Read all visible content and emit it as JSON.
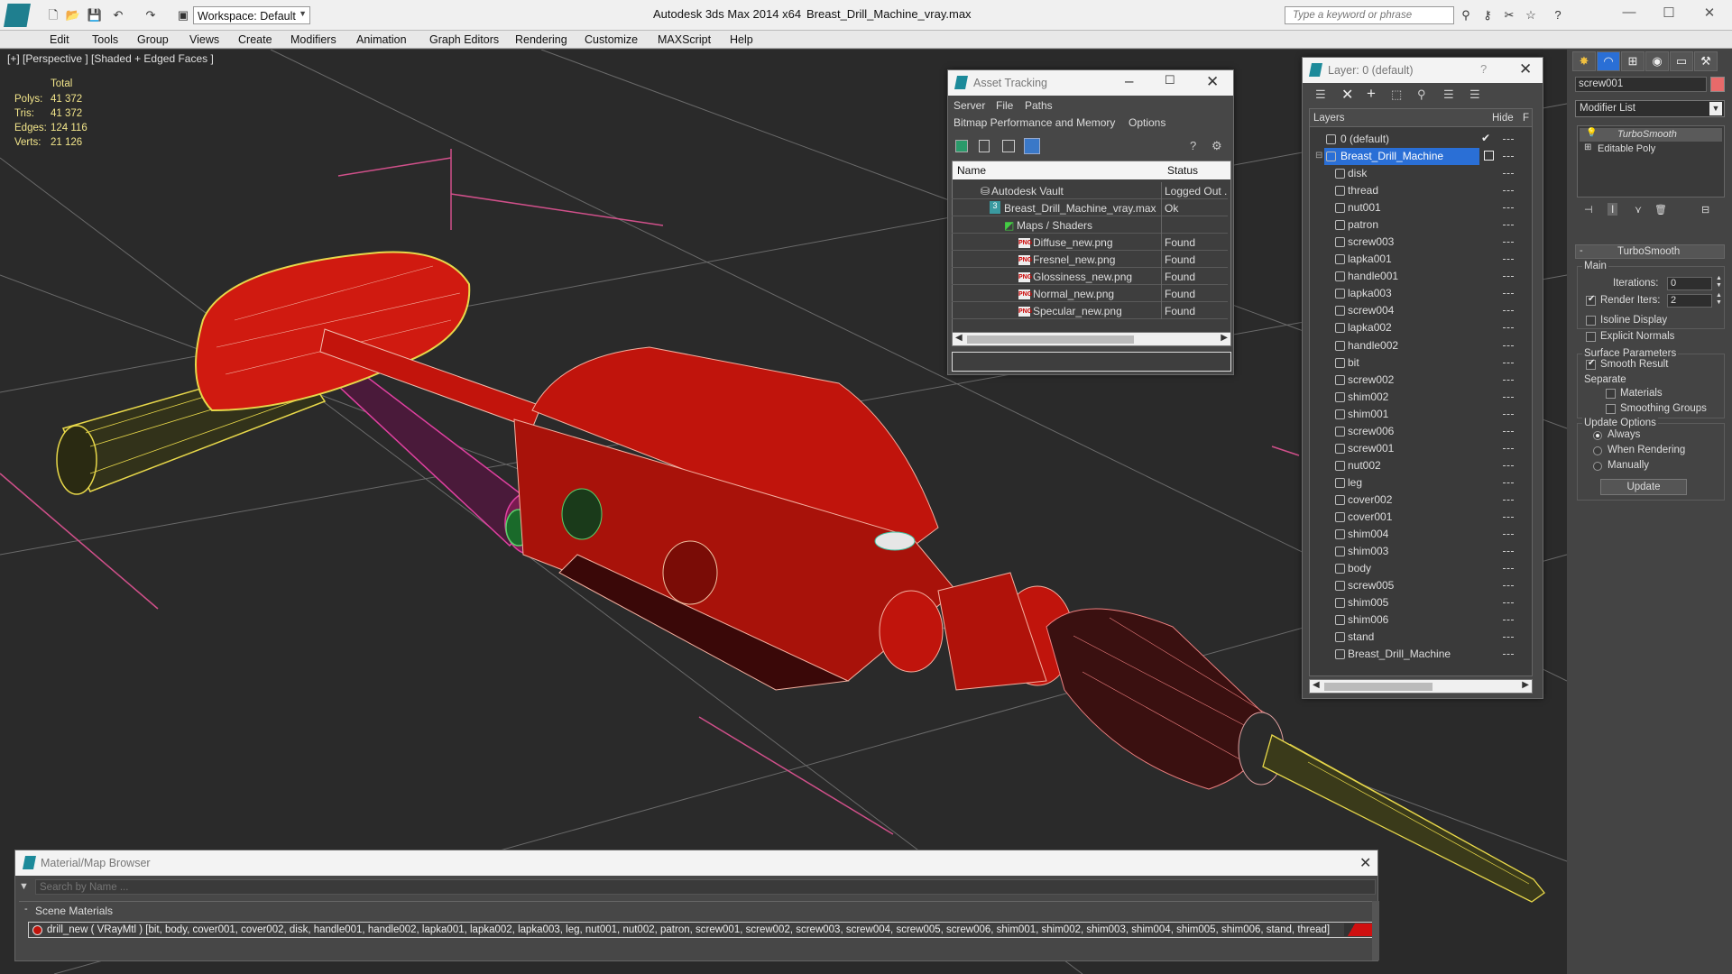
{
  "app": {
    "title": "Autodesk 3ds Max  2014 x64",
    "filename": "Breast_Drill_Machine_vray.max",
    "workspace_label": "Workspace: Default",
    "search_placeholder": "Type a keyword or phrase"
  },
  "menu": [
    "Edit",
    "Tools",
    "Group",
    "Views",
    "Create",
    "Modifiers",
    "Animation",
    "Graph Editors",
    "Rendering",
    "Customize",
    "MAXScript",
    "Help"
  ],
  "viewport": {
    "label": "[+] [Perspective ] [Shaded + Edged Faces ]",
    "stats": {
      "total_label": "Total",
      "rows": [
        {
          "label": "Polys:",
          "value": "41 372"
        },
        {
          "label": "Tris:",
          "value": "41 372"
        },
        {
          "label": "Edges:",
          "value": "124 116"
        },
        {
          "label": "Verts:",
          "value": "21 126"
        }
      ]
    }
  },
  "asset_tracking": {
    "title": "Asset Tracking",
    "menu1": [
      "Server",
      "File",
      "Paths"
    ],
    "menu2": [
      "Bitmap Performance and Memory",
      "Options"
    ],
    "col_name": "Name",
    "col_status": "Status",
    "rows": [
      {
        "name": "Autodesk Vault",
        "status": "Logged Out ."
      },
      {
        "name": "Breast_Drill_Machine_vray.max",
        "status": "Ok"
      },
      {
        "name": "Maps / Shaders",
        "status": ""
      },
      {
        "name": "Diffuse_new.png",
        "status": "Found"
      },
      {
        "name": "Fresnel_new.png",
        "status": "Found"
      },
      {
        "name": "Glossiness_new.png",
        "status": "Found"
      },
      {
        "name": "Normal_new.png",
        "status": "Found"
      },
      {
        "name": "Specular_new.png",
        "status": "Found"
      }
    ]
  },
  "layer_window": {
    "title": "Layer: 0 (default)",
    "help": "?",
    "col_layers": "Layers",
    "col_hide": "Hide",
    "col_f": "F",
    "default_layer": "0 (default)",
    "selected_layer": "Breast_Drill_Machine",
    "objects": [
      "disk",
      "thread",
      "nut001",
      "patron",
      "screw003",
      "lapka001",
      "handle001",
      "lapka003",
      "screw004",
      "lapka002",
      "handle002",
      "bit",
      "screw002",
      "shim002",
      "shim001",
      "screw006",
      "screw001",
      "nut002",
      "leg",
      "cover002",
      "cover001",
      "shim004",
      "shim003",
      "body",
      "screw005",
      "shim005",
      "shim006",
      "stand",
      "Breast_Drill_Machine"
    ]
  },
  "command_panel": {
    "object_name": "screw001",
    "object_color": "#e86a6a",
    "modifier_list": "Modifier List",
    "stack": [
      "TurboSmooth",
      "Editable Poly"
    ],
    "rollout": "TurboSmooth",
    "main_label": "Main",
    "iterations_label": "Iterations:",
    "iterations_value": "0",
    "render_iters_label": "Render Iters:",
    "render_iters_value": "2",
    "render_iters_checked": true,
    "isoline_label": "Isoline Display",
    "explicit_normals_label": "Explicit Normals",
    "surface_params_label": "Surface Parameters",
    "smooth_result_label": "Smooth Result",
    "separate_label": "Separate",
    "materials_label": "Materials",
    "smoothing_groups_label": "Smoothing Groups",
    "update_options_label": "Update Options",
    "always_label": "Always",
    "when_rendering_label": "When Rendering",
    "manually_label": "Manually",
    "update_button": "Update"
  },
  "material_browser": {
    "title": "Material/Map Browser",
    "search_placeholder": "Search by Name ...",
    "section": "Scene Materials",
    "material_line": "drill_new  ( VRayMtl )  [bit, body, cover001, cover002, disk, handle001, handle002, lapka001, lapka002, lapka003, leg, nut001, nut002, patron, screw001, screw002, screw003, screw004, screw005, screw006, shim001, shim002, shim003, shim004, shim005, shim006, stand, thread]"
  },
  "colors": {
    "drill_body": "#c0140c",
    "wire_yellow": "#e8d84a",
    "selection_blue": "#2a6fd6",
    "viewport_bg": "#2a2a2a"
  }
}
